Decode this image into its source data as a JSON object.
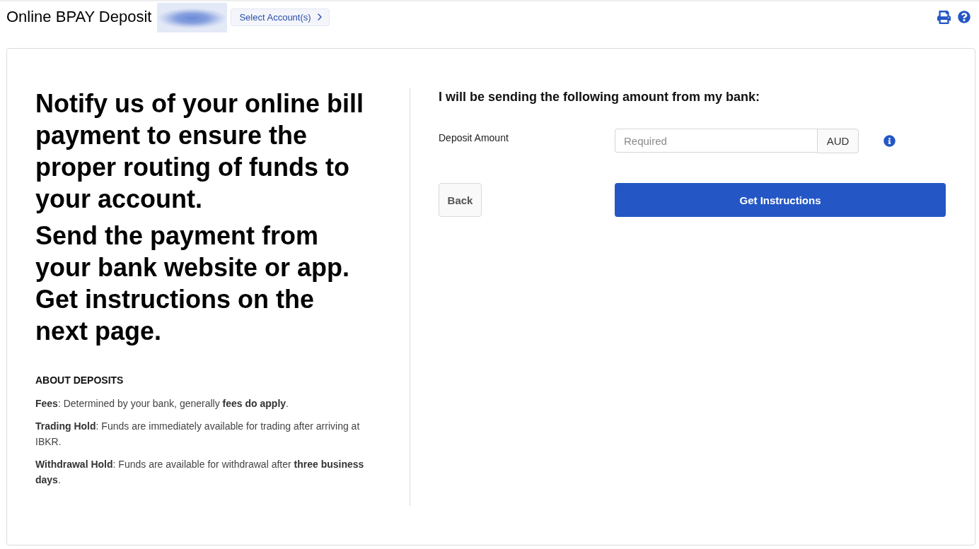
{
  "header": {
    "title": "Online BPAY Deposit",
    "account_button": {
      "label": "Select Account(s)"
    }
  },
  "intro": {
    "headline": [
      "Notify us of your online bill payment to ensure the proper routing of funds to your account.",
      "Send the payment from your bank website or app. Get instructions on the next page."
    ]
  },
  "about": {
    "heading": "ABOUT DEPOSITS",
    "notes": [
      "**Fees**: Determined by your bank, generally **fees do apply**.",
      "**Trading Hold**: Funds are immediately available for trading after arriving at IBKR.",
      "**Withdrawal Hold**: Funds are available for withdrawal after **three business days**."
    ]
  },
  "form": {
    "heading": "I will be sending the following amount from my bank:",
    "deposit_amount": {
      "label": "Deposit Amount",
      "placeholder": "Required",
      "currency": "AUD"
    },
    "buttons": {
      "back": "Back",
      "submit": "Get Instructions"
    }
  }
}
